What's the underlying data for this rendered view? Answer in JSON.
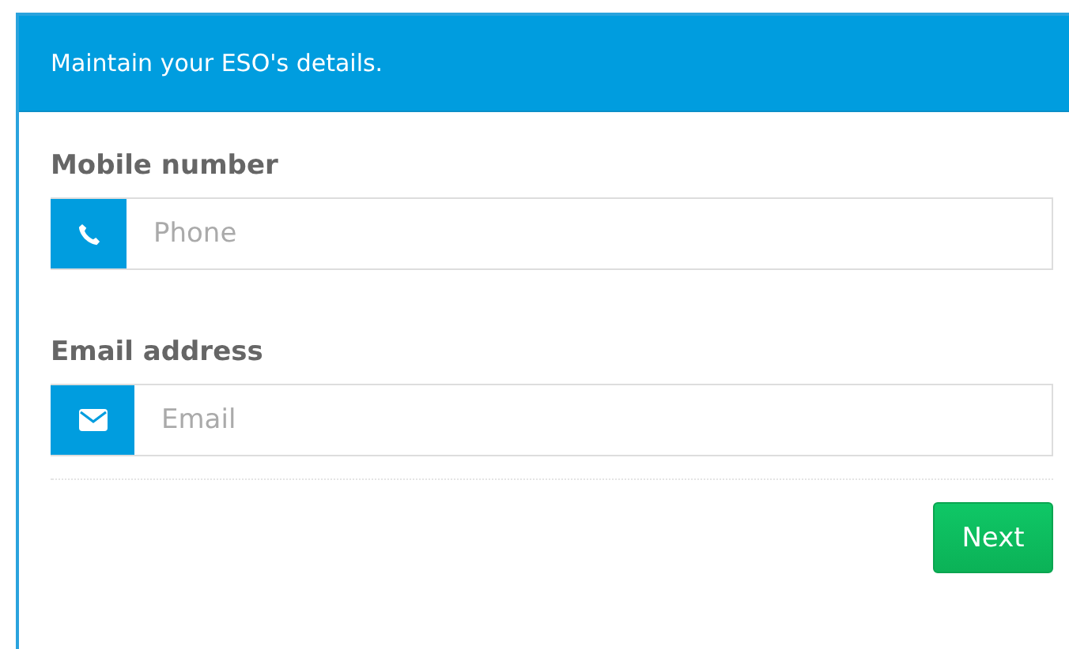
{
  "header": {
    "title": "Maintain your ESO's details."
  },
  "fields": [
    {
      "label": "Mobile number",
      "kind": "phone",
      "placeholder": "Phone"
    },
    {
      "label": "Email address",
      "kind": "email",
      "placeholder": "Email"
    }
  ],
  "buttons": [
    "Next"
  ]
}
